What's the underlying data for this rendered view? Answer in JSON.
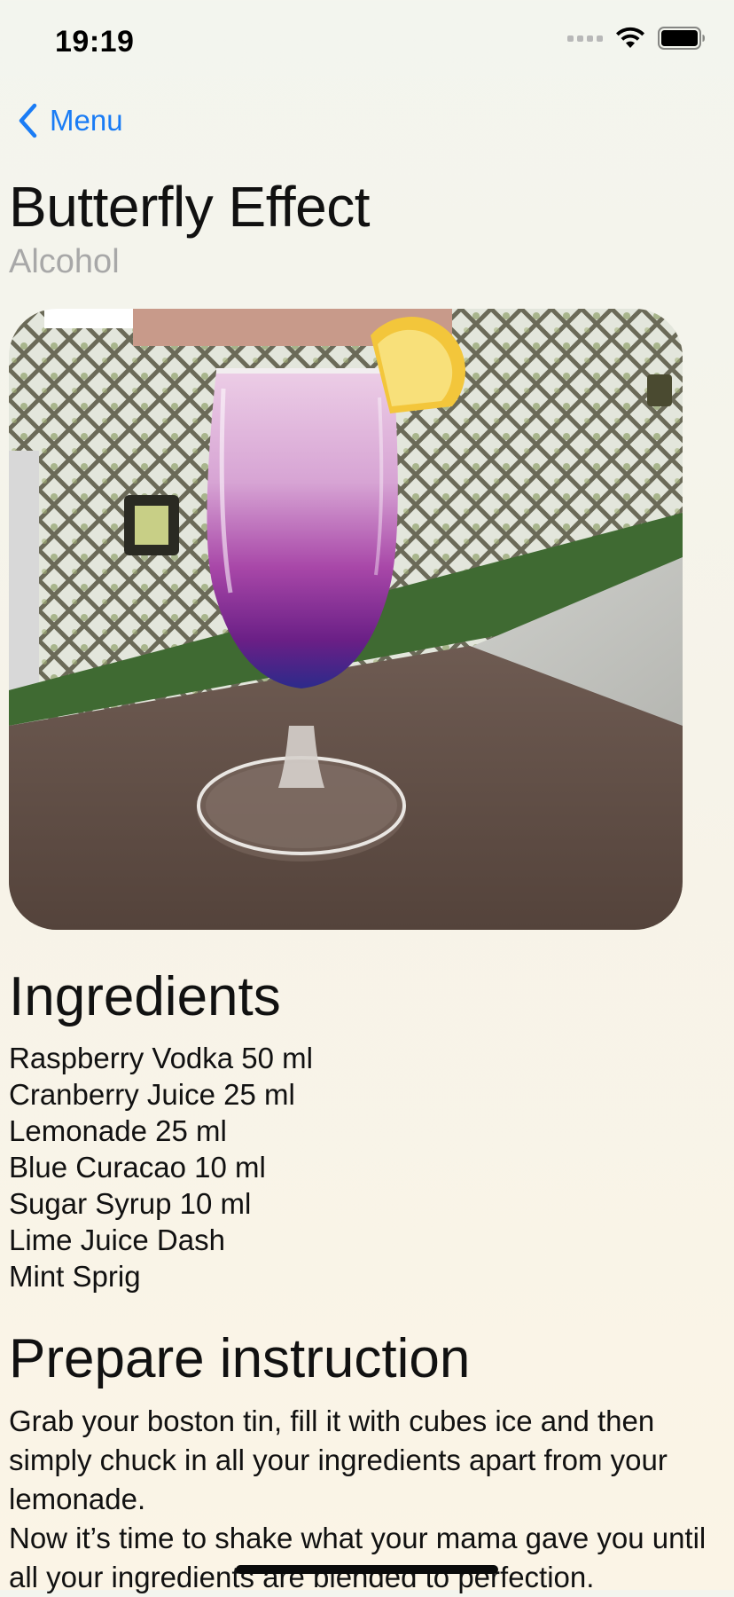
{
  "status_bar": {
    "time": "19:19"
  },
  "nav": {
    "back_label": "Menu"
  },
  "drink": {
    "name": "Butterfly Effect",
    "category": "Alcohol"
  },
  "ingredients": {
    "heading": "Ingredients",
    "items": [
      "Raspberry Vodka 50 ml",
      "Cranberry Juice 25 ml",
      "Lemonade 25 ml",
      "Blue Curacao 10 ml",
      "Sugar Syrup 10 ml",
      "Lime Juice Dash",
      "Mint Sprig"
    ]
  },
  "instructions": {
    "heading": "Prepare instruction",
    "paragraphs": [
      "Grab your boston tin, fill it with cubes ice and then simply chuck in all your ingredients apart from your lemonade.",
      "Now it’s time to shake what your mama gave you until all your ingredients are blended to perfection."
    ]
  },
  "icons": {
    "back": "chevron-left-icon",
    "signal": "cellular-signal-icon",
    "wifi": "wifi-icon",
    "battery": "battery-icon"
  },
  "colors": {
    "accent": "#1a7cf5",
    "subtitle": "#a8a8a8"
  }
}
